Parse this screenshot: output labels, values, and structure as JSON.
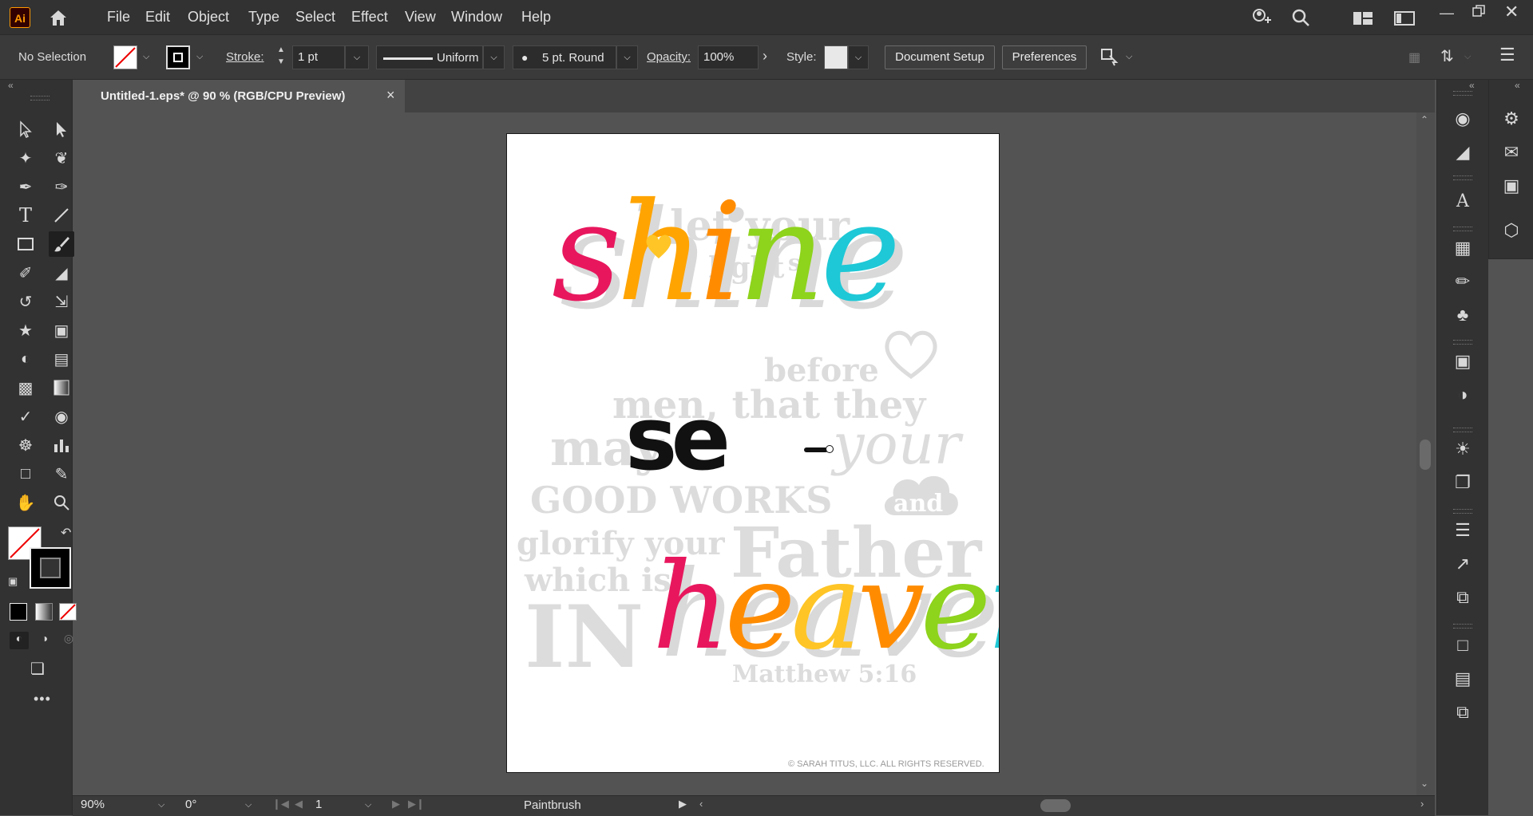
{
  "app": {
    "logo": "Ai"
  },
  "menu": [
    "File",
    "Edit",
    "Object",
    "Type",
    "Select",
    "Effect",
    "View",
    "Window",
    "Help"
  ],
  "control_bar": {
    "selection": "No Selection",
    "stroke_label": "Stroke:",
    "stroke_weight": "1 pt",
    "stroke_profile": "Uniform",
    "brush": "5 pt. Round",
    "opacity_label": "Opacity:",
    "opacity": "100%",
    "style_label": "Style:",
    "document_setup": "Document Setup",
    "preferences": "Preferences"
  },
  "tab": {
    "title": "Untitled-1.eps* @ 90 % (RGB/CPU Preview)",
    "close": "×"
  },
  "status_bar": {
    "zoom": "90%",
    "rotation": "0°",
    "artboard": "1",
    "tool": "Paintbrush"
  },
  "artwork": {
    "line1": "let your",
    "line2a": "light",
    "line2b": "so",
    "shine": "shine",
    "before": "before",
    "men": "men, that they",
    "may": "may",
    "se": "se",
    "your": "your",
    "good_works": "GOOD WORKS",
    "and": "and",
    "glorify": "glorify your",
    "father": "Father",
    "which": "which is",
    "in": "IN",
    "heaven": "heaven",
    "reference": "Matthew 5:16",
    "copyright": "© SARAH TITUS, LLC. ALL RIGHTS RESERVED."
  },
  "colors": {
    "shine": [
      "#e8175d",
      "#ffa400",
      "#ff8c00",
      "#8ed31c",
      "#1ec8d6"
    ],
    "heaven": [
      "#e8175d",
      "#ff8c00",
      "#ffc526",
      "#ff8c00",
      "#8ed31c",
      "#1ec8d6"
    ],
    "heart": "#ffc526"
  }
}
